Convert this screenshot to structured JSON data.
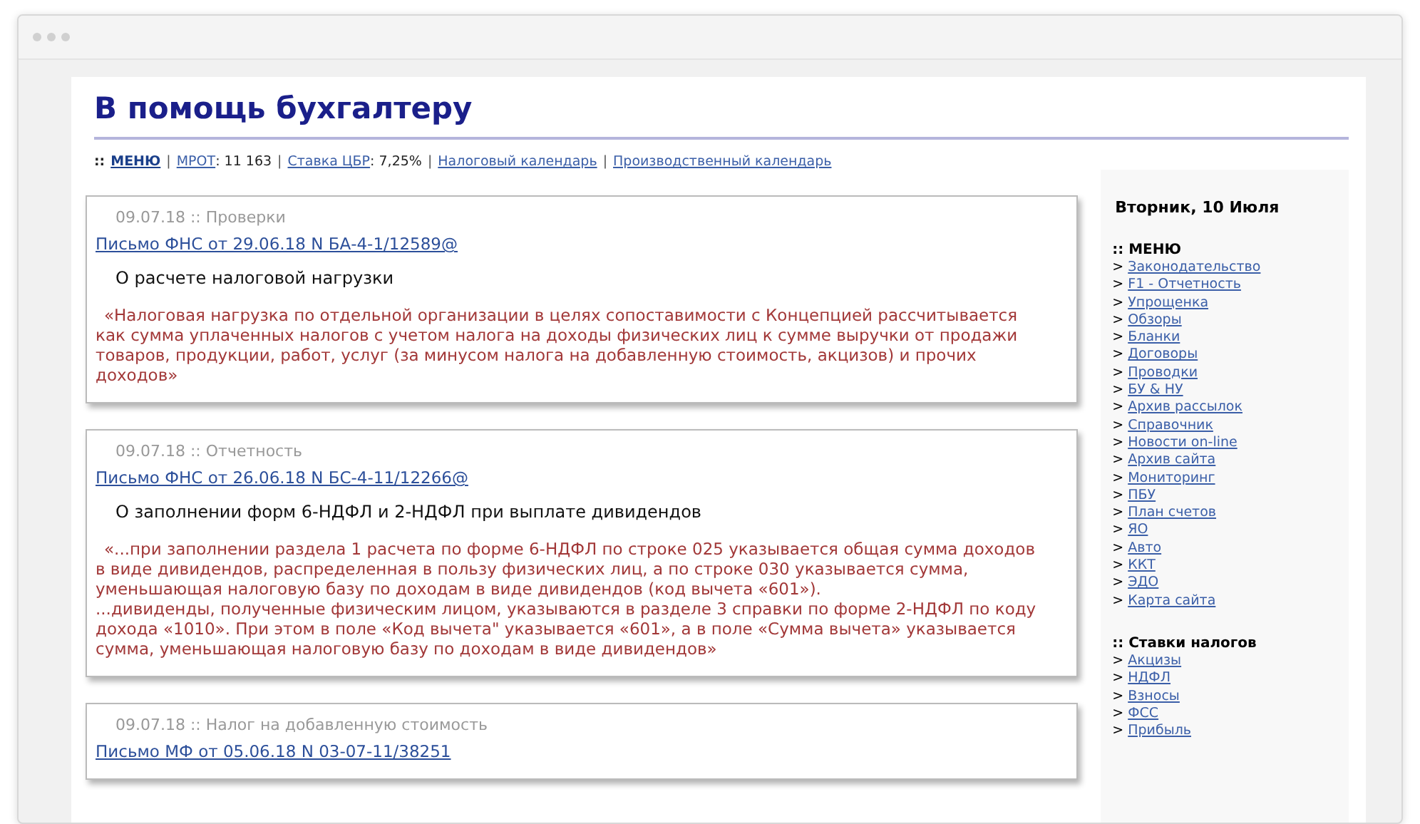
{
  "site": {
    "title": "В помощь бухгалтеру"
  },
  "nav": {
    "prefix": "::",
    "items": [
      {
        "label": "МЕНЮ",
        "bold": true
      },
      {
        "separator": "|",
        "label": "МРОТ",
        "bold": false,
        "value": ": 11 163"
      },
      {
        "separator": "|",
        "label": "Ставка ЦБР",
        "bold": false,
        "value": ": 7,25%"
      },
      {
        "separator": "|",
        "label": "Налоговый календарь",
        "bold": false
      },
      {
        "separator": "|",
        "label": "Производственный календарь",
        "bold": false
      }
    ]
  },
  "articles": [
    {
      "meta": "09.07.18 :: Проверки",
      "link": "Письмо ФНС от 29.06.18 N БА-4-1/12589@",
      "heading": "О расчете налоговой нагрузки",
      "quote": "«Налоговая нагрузка по отдельной организации в целях сопоставимости с Концепцией рассчитывается как сумма уплаченных налогов с учетом налога на доходы физических лиц к сумме выручки от продажи товаров, продукции, работ, услуг (за минусом налога на добавленную стоимость, акцизов) и прочих доходов»"
    },
    {
      "meta": "09.07.18 :: Отчетность",
      "link": "Письмо ФНС от 26.06.18 N БС-4-11/12266@",
      "heading": "О заполнении форм 6-НДФЛ и 2-НДФЛ при выплате дивидендов",
      "quote": "«...при заполнении раздела 1 расчета по форме 6-НДФЛ по строке 025 указывается общая сумма доходов в виде дивидендов, распределенная в пользу физических лиц, а по строке 030 указывается сумма, уменьшающая налоговую базу по доходам в виде дивидендов (код вычета «601»).\n...дивиденды, полученные физическим лицом, указываются в разделе 3 справки по форме 2-НДФЛ по коду дохода «1010». При этом в поле «Код вычета\" указывается «601», а в поле «Сумма вычета» указывается сумма, уменьшающая налоговую базу по доходам в виде дивидендов»"
    },
    {
      "meta": "09.07.18 :: Налог на добавленную стоимость",
      "link": "Письмо МФ от 05.06.18 N 03-07-11/38251"
    }
  ],
  "sidebar": {
    "date": "Вторник, 10 Июля",
    "sections": [
      {
        "prefix": "::",
        "title": "МЕНЮ",
        "items": [
          {
            "bullet": ">",
            "label": "Законодательство"
          },
          {
            "bullet": ">",
            "label": "F1 - Отчетность"
          },
          {
            "bullet": ">",
            "label": "Упрощенка"
          },
          {
            "bullet": ">",
            "label": "Обзоры"
          },
          {
            "bullet": ">",
            "label": "Бланки"
          },
          {
            "bullet": ">",
            "label": "Договоры"
          },
          {
            "bullet": ">",
            "label": "Проводки"
          },
          {
            "bullet": ">",
            "label": "БУ & НУ"
          },
          {
            "bullet": ">",
            "label": "Архив рассылок"
          },
          {
            "bullet": ">",
            "label": "Справочник"
          },
          {
            "bullet": ">",
            "label": "Новости on-line"
          },
          {
            "bullet": ">",
            "label": "Архив сайта"
          },
          {
            "bullet": ">",
            "label": "Мониторинг"
          },
          {
            "bullet": ">",
            "label": "ПБУ"
          },
          {
            "bullet": ">",
            "label": "План счетов"
          },
          {
            "bullet": ">",
            "label": "ЯО"
          },
          {
            "bullet": ">",
            "label": "Авто"
          },
          {
            "bullet": ">",
            "label": "ККТ"
          },
          {
            "bullet": ">",
            "label": "ЭДО"
          },
          {
            "bullet": ">",
            "label": "Карта сайта"
          }
        ]
      },
      {
        "prefix": "::",
        "title": "Ставки налогов",
        "items": [
          {
            "bullet": ">",
            "label": "Акцизы"
          },
          {
            "bullet": ">",
            "label": "НДФЛ"
          },
          {
            "bullet": ">",
            "label": "Взносы"
          },
          {
            "bullet": ">",
            "label": "ФСС"
          },
          {
            "bullet": ">",
            "label": "Прибыль"
          }
        ]
      }
    ]
  }
}
